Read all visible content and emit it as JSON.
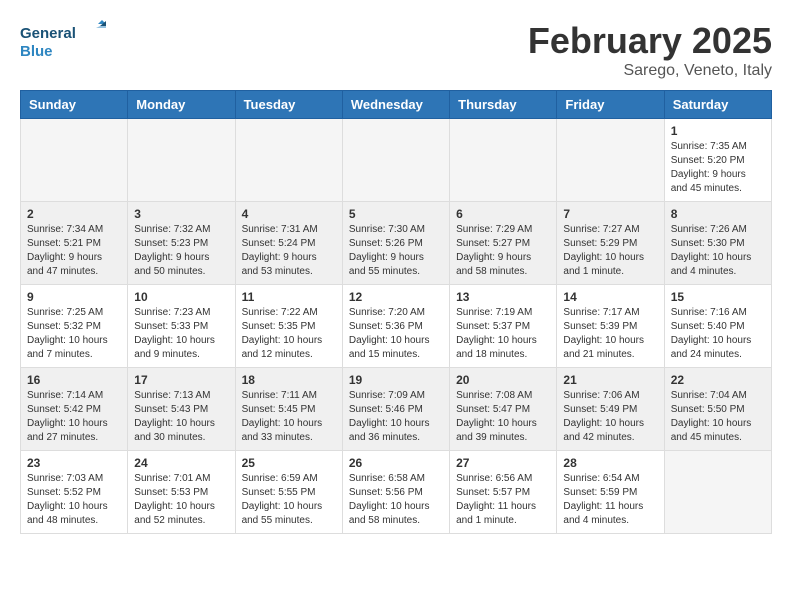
{
  "header": {
    "logo_text_general": "General",
    "logo_text_blue": "Blue",
    "month": "February 2025",
    "location": "Sarego, Veneto, Italy"
  },
  "days_of_week": [
    "Sunday",
    "Monday",
    "Tuesday",
    "Wednesday",
    "Thursday",
    "Friday",
    "Saturday"
  ],
  "weeks": [
    [
      {
        "day": "",
        "info": ""
      },
      {
        "day": "",
        "info": ""
      },
      {
        "day": "",
        "info": ""
      },
      {
        "day": "",
        "info": ""
      },
      {
        "day": "",
        "info": ""
      },
      {
        "day": "",
        "info": ""
      },
      {
        "day": "1",
        "info": "Sunrise: 7:35 AM\nSunset: 5:20 PM\nDaylight: 9 hours and 45 minutes."
      }
    ],
    [
      {
        "day": "2",
        "info": "Sunrise: 7:34 AM\nSunset: 5:21 PM\nDaylight: 9 hours and 47 minutes."
      },
      {
        "day": "3",
        "info": "Sunrise: 7:32 AM\nSunset: 5:23 PM\nDaylight: 9 hours and 50 minutes."
      },
      {
        "day": "4",
        "info": "Sunrise: 7:31 AM\nSunset: 5:24 PM\nDaylight: 9 hours and 53 minutes."
      },
      {
        "day": "5",
        "info": "Sunrise: 7:30 AM\nSunset: 5:26 PM\nDaylight: 9 hours and 55 minutes."
      },
      {
        "day": "6",
        "info": "Sunrise: 7:29 AM\nSunset: 5:27 PM\nDaylight: 9 hours and 58 minutes."
      },
      {
        "day": "7",
        "info": "Sunrise: 7:27 AM\nSunset: 5:29 PM\nDaylight: 10 hours and 1 minute."
      },
      {
        "day": "8",
        "info": "Sunrise: 7:26 AM\nSunset: 5:30 PM\nDaylight: 10 hours and 4 minutes."
      }
    ],
    [
      {
        "day": "9",
        "info": "Sunrise: 7:25 AM\nSunset: 5:32 PM\nDaylight: 10 hours and 7 minutes."
      },
      {
        "day": "10",
        "info": "Sunrise: 7:23 AM\nSunset: 5:33 PM\nDaylight: 10 hours and 9 minutes."
      },
      {
        "day": "11",
        "info": "Sunrise: 7:22 AM\nSunset: 5:35 PM\nDaylight: 10 hours and 12 minutes."
      },
      {
        "day": "12",
        "info": "Sunrise: 7:20 AM\nSunset: 5:36 PM\nDaylight: 10 hours and 15 minutes."
      },
      {
        "day": "13",
        "info": "Sunrise: 7:19 AM\nSunset: 5:37 PM\nDaylight: 10 hours and 18 minutes."
      },
      {
        "day": "14",
        "info": "Sunrise: 7:17 AM\nSunset: 5:39 PM\nDaylight: 10 hours and 21 minutes."
      },
      {
        "day": "15",
        "info": "Sunrise: 7:16 AM\nSunset: 5:40 PM\nDaylight: 10 hours and 24 minutes."
      }
    ],
    [
      {
        "day": "16",
        "info": "Sunrise: 7:14 AM\nSunset: 5:42 PM\nDaylight: 10 hours and 27 minutes."
      },
      {
        "day": "17",
        "info": "Sunrise: 7:13 AM\nSunset: 5:43 PM\nDaylight: 10 hours and 30 minutes."
      },
      {
        "day": "18",
        "info": "Sunrise: 7:11 AM\nSunset: 5:45 PM\nDaylight: 10 hours and 33 minutes."
      },
      {
        "day": "19",
        "info": "Sunrise: 7:09 AM\nSunset: 5:46 PM\nDaylight: 10 hours and 36 minutes."
      },
      {
        "day": "20",
        "info": "Sunrise: 7:08 AM\nSunset: 5:47 PM\nDaylight: 10 hours and 39 minutes."
      },
      {
        "day": "21",
        "info": "Sunrise: 7:06 AM\nSunset: 5:49 PM\nDaylight: 10 hours and 42 minutes."
      },
      {
        "day": "22",
        "info": "Sunrise: 7:04 AM\nSunset: 5:50 PM\nDaylight: 10 hours and 45 minutes."
      }
    ],
    [
      {
        "day": "23",
        "info": "Sunrise: 7:03 AM\nSunset: 5:52 PM\nDaylight: 10 hours and 48 minutes."
      },
      {
        "day": "24",
        "info": "Sunrise: 7:01 AM\nSunset: 5:53 PM\nDaylight: 10 hours and 52 minutes."
      },
      {
        "day": "25",
        "info": "Sunrise: 6:59 AM\nSunset: 5:55 PM\nDaylight: 10 hours and 55 minutes."
      },
      {
        "day": "26",
        "info": "Sunrise: 6:58 AM\nSunset: 5:56 PM\nDaylight: 10 hours and 58 minutes."
      },
      {
        "day": "27",
        "info": "Sunrise: 6:56 AM\nSunset: 5:57 PM\nDaylight: 11 hours and 1 minute."
      },
      {
        "day": "28",
        "info": "Sunrise: 6:54 AM\nSunset: 5:59 PM\nDaylight: 11 hours and 4 minutes."
      },
      {
        "day": "",
        "info": ""
      }
    ]
  ]
}
